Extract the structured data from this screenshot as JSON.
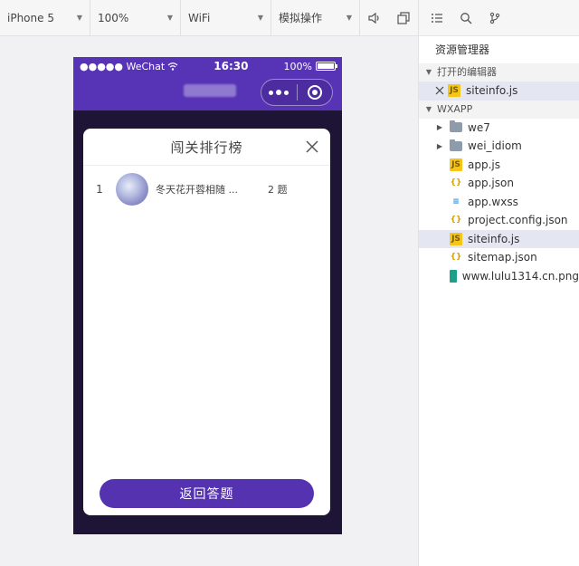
{
  "toolbar": {
    "device": "iPhone 5",
    "zoom": "100%",
    "network": "WiFi",
    "operation": "模拟操作"
  },
  "phone": {
    "status": {
      "carrier": "●●●●● WeChat",
      "time": "16:30",
      "battery": "100%"
    },
    "modal": {
      "title": "闯关排行榜",
      "rows": [
        {
          "rank": "1",
          "name": "冬天花开蓉相随 ...",
          "score": "2 题"
        }
      ],
      "return_label": "返回答题"
    }
  },
  "explorer": {
    "title": "资源管理器",
    "open_editors_label": "打开的编辑器",
    "open_editors": [
      {
        "name": "siteinfo.js",
        "icon": "js-file-icon"
      }
    ],
    "project_label": "WXAPP",
    "files": [
      {
        "name": "we7",
        "type": "folder"
      },
      {
        "name": "wei_idiom",
        "type": "folder"
      },
      {
        "name": "app.js",
        "type": "js"
      },
      {
        "name": "app.json",
        "type": "json"
      },
      {
        "name": "app.wxss",
        "type": "css"
      },
      {
        "name": "project.config.json",
        "type": "json"
      },
      {
        "name": "siteinfo.js",
        "type": "js"
      },
      {
        "name": "sitemap.json",
        "type": "json"
      },
      {
        "name": "www.lulu1314.cn.png",
        "type": "png"
      }
    ]
  },
  "colors": {
    "header_purple": "#5733b5",
    "button_purple": "#5432b0",
    "phone_bg": "#1e1436",
    "selected_row": "#e4e6f1"
  }
}
